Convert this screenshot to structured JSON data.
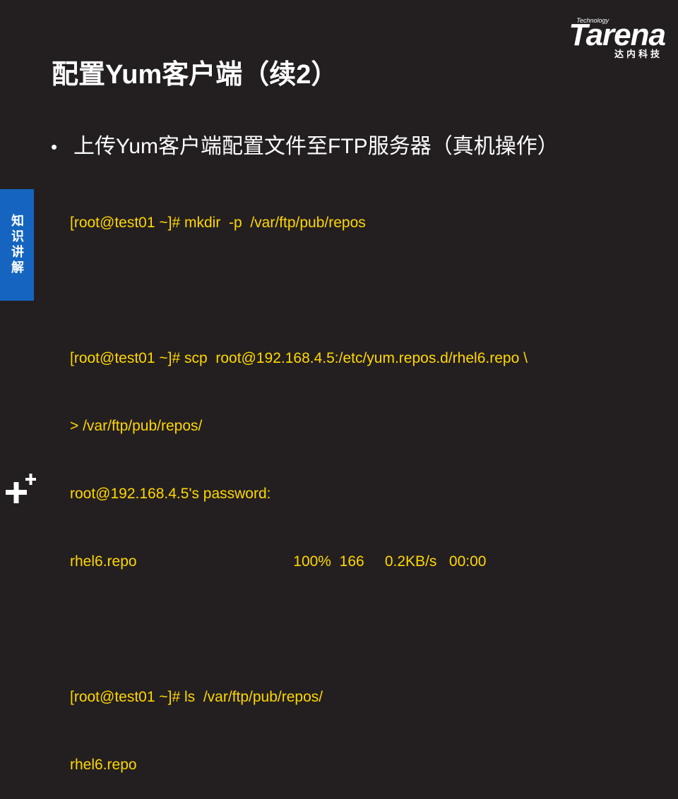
{
  "logo": {
    "technology": "Technology",
    "brand": "Tarena",
    "subtitle": "达内科技"
  },
  "title": "配置Yum客户端（续2）",
  "bullet": {
    "symbol": "•",
    "text": "上传Yum客户端配置文件至FTP服务器（真机操作）"
  },
  "code_lines": [
    "[root@test01 ~]# mkdir  -p  /var/ftp/pub/repos",
    "",
    "[root@test01 ~]# scp  root@192.168.4.5:/etc/yum.repos.d/rhel6.repo \\",
    "> /var/ftp/pub/repos/",
    "root@192.168.4.5's password:",
    "rhel6.repo                                      100%  166     0.2KB/s   00:00",
    "",
    "[root@test01 ~]# ls  /var/ftp/pub/repos/",
    "rhel6.repo"
  ],
  "side_tab": {
    "label": "知识讲解"
  },
  "colors": {
    "background": "#231f20",
    "code": "#ffd700",
    "side_tab": "#1565c0"
  }
}
